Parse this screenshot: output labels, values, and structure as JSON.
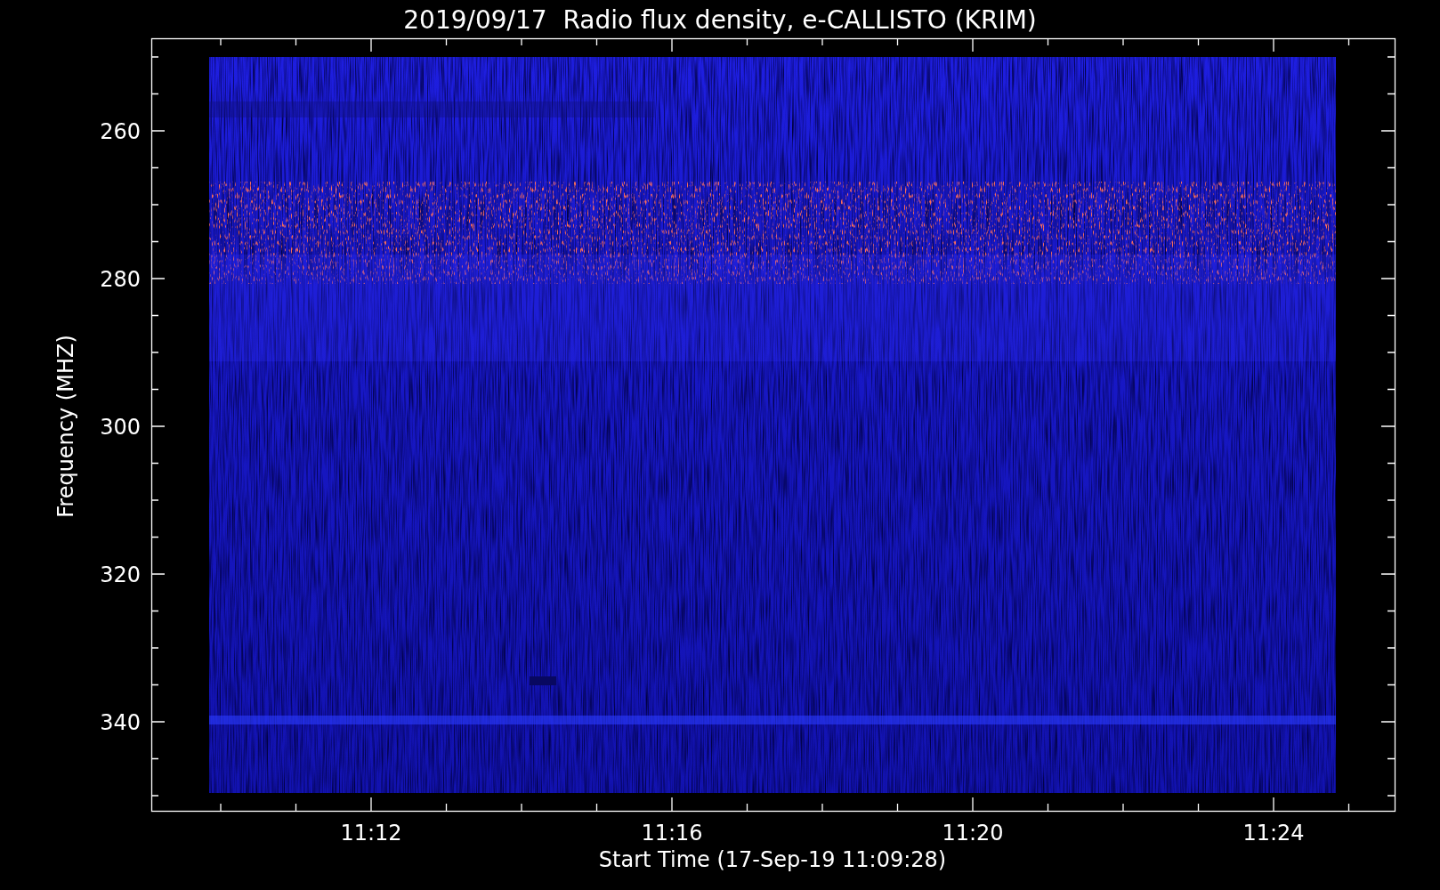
{
  "title": "2019/09/17  Radio flux density, e-CALLISTO (KRIM)",
  "y_axis": {
    "label": "Frequency (MHZ)",
    "ticks": [
      "260",
      "280",
      "300",
      "320",
      "340"
    ]
  },
  "x_axis": {
    "label": "Start Time (17-Sep-19 11:09:28)",
    "ticks": [
      "11:12",
      "11:16",
      "11:20",
      "11:24"
    ]
  }
}
